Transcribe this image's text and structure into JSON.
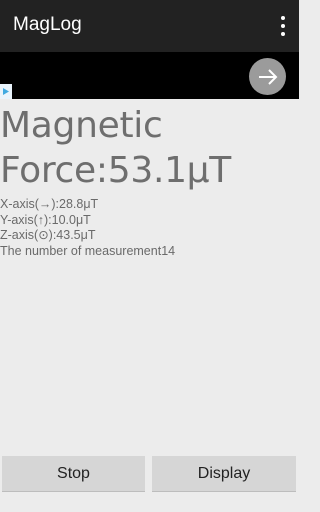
{
  "appbar": {
    "title": "MagLog",
    "overflow_icon": "overflow-menu-icon"
  },
  "ad": {
    "arrow_icon": "arrow-right-icon",
    "info_icon": "ad-choices-icon"
  },
  "measurement": {
    "headline_line1": "Magnetic",
    "headline_line2": "Force:53.1μT",
    "x_axis": "X-axis(→):28.8μT",
    "y_axis": "Y-axis(↑):10.0μT",
    "z_axis": "Z-axis(⊙):43.5μT",
    "count": "The number of measurement14"
  },
  "buttons": {
    "stop": "Stop",
    "display": "Display"
  },
  "colors": {
    "appbar": "#222222",
    "background": "#ececec",
    "button": "#d6d6d6"
  }
}
